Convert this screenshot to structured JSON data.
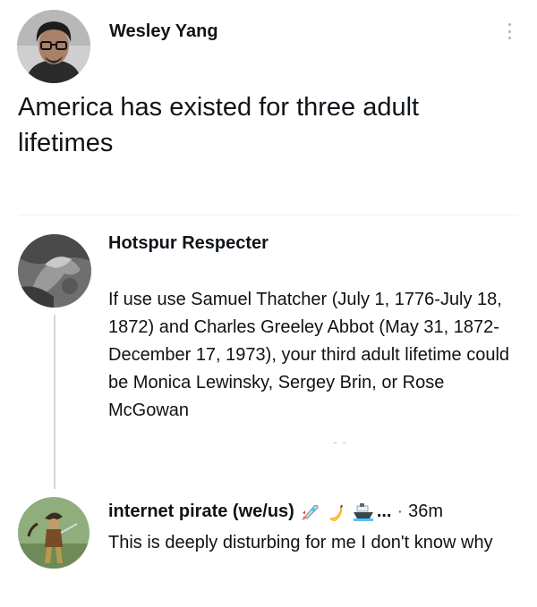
{
  "main_post": {
    "author": "Wesley Yang",
    "text": "America has existed for three adult lifetimes"
  },
  "reply_1": {
    "author": "Hotspur Respecter",
    "text": "If use use Samuel Thatcher (July 1, 1776-July 18, 1872) and Charles Greeley Abbot (May 31, 1872-December 17, 1973), your third adult lifetime could be Monica Lewinsky, Sergey Brin, or Rose McGowan",
    "more_marker": "- -"
  },
  "reply_2": {
    "author": "internet pirate (we/us)",
    "emoji_icons": [
      "rocket-icon",
      "banana-icon",
      "ship-icon"
    ],
    "ellipsis": "...",
    "separator": "·",
    "time": "36m",
    "text": "This is deeply disturbing for me I don't know why"
  },
  "colors": {
    "text": "#0f1419",
    "thread_line": "#cfd9de",
    "muted": "#536471"
  }
}
